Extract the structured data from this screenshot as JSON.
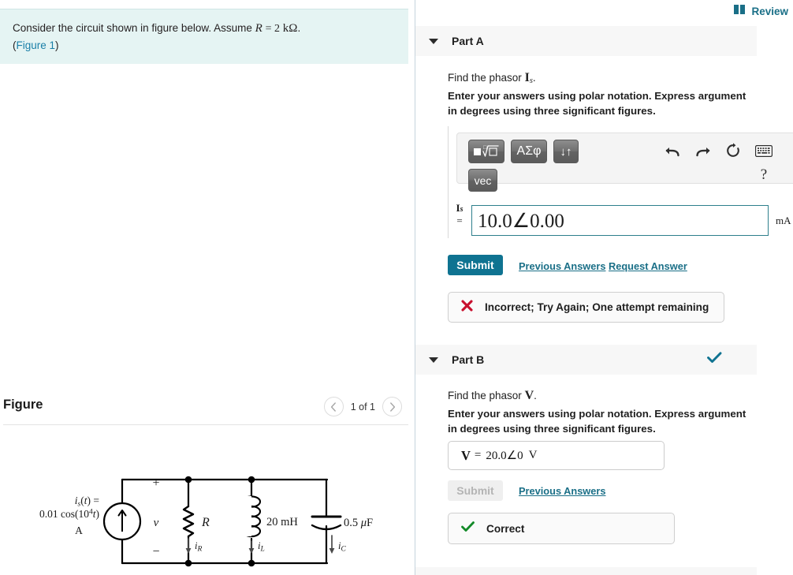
{
  "left": {
    "problem": {
      "text_before": "Consider the circuit shown in figure below. Assume",
      "assume_var": "R",
      "assume_eq": "= 2",
      "assume_unit": "kΩ",
      "period": ".",
      "figure_link_open": "(",
      "figure_link": "Figure 1",
      "figure_link_close": ")"
    },
    "figure": {
      "title": "Figure",
      "prev_icon": "chevron-left-icon",
      "counter": "1 of 1",
      "next_icon": "chevron-right-icon"
    },
    "circuit": {
      "source_line1": "i",
      "source_line1_sub": "s",
      "source_line1_rest": "(t) =",
      "source_line2": "0.01 cos(10",
      "source_line2_exp": "4",
      "source_line2_rest": "t)",
      "source_line3": "A",
      "plus_sign": "+",
      "minus_sign": "−",
      "voltage_label": "v",
      "resistor_label": "R",
      "inductor_label": "20 mH",
      "capacitor_label": "0.5 μF",
      "current_r": "i",
      "current_r_sub": "R",
      "current_l": "i",
      "current_l_sub": "L",
      "current_c": "i",
      "current_c_sub": "C"
    }
  },
  "right": {
    "review": {
      "icon": "book-icon",
      "label": "Review"
    },
    "parts": [
      {
        "id": "part-a",
        "caret_icon": "caret-down-icon",
        "title": "Part A",
        "status_icon": null,
        "prompt_prefix": "Find the phasor",
        "prompt_symbol": "I",
        "prompt_subscript": "s",
        "prompt_suffix": ".",
        "instruction": "Enter your answers using polar notation. Express argument in degrees using three significant figures.",
        "toolbar": {
          "buttons": [
            {
              "name": "template-sqrt-button",
              "label": "■√□"
            },
            {
              "name": "greek-symbols-button",
              "label": "ΑΣφ"
            },
            {
              "name": "more-templates-button",
              "label": "↓↑"
            },
            {
              "name": "vector-button",
              "label": "vec"
            }
          ],
          "icons": [
            {
              "name": "undo-icon",
              "label": "undo"
            },
            {
              "name": "redo-icon",
              "label": "redo"
            },
            {
              "name": "reset-icon",
              "label": "reset"
            },
            {
              "name": "keyboard-icon",
              "label": "keyboard"
            },
            {
              "name": "help-icon",
              "label": "?"
            }
          ]
        },
        "answer": {
          "label_symbol": "I",
          "label_subscript": "s",
          "label_equals": "=",
          "value": "10.0∠0.00",
          "value_magnitude": "10.0",
          "value_angle": "0.00",
          "unit": "mA"
        },
        "submit_label": "Submit",
        "submit_enabled": true,
        "links": [
          "Previous Answers",
          "Request Answer"
        ],
        "feedback": {
          "icon": "cross-icon",
          "icon_color": "#c8102e",
          "text": "Incorrect; Try Again; One attempt remaining"
        }
      },
      {
        "id": "part-b",
        "caret_icon": "caret-down-icon",
        "title": "Part B",
        "status_icon": "check-icon",
        "status_color": "#0f7391",
        "prompt_prefix": "Find the phasor",
        "prompt_symbol": "V",
        "prompt_subscript": "",
        "prompt_suffix": ".",
        "instruction": "Enter your answers using polar notation. Express argument in degrees using three significant figures.",
        "answer": {
          "label_symbol": "V",
          "label_equals": "=",
          "value": "20.0∠0",
          "unit": "V"
        },
        "submit_label": "Submit",
        "submit_enabled": false,
        "links": [
          "Previous Answers"
        ],
        "feedback": {
          "icon": "check-icon",
          "icon_color": "#128a28",
          "text": "Correct"
        }
      }
    ]
  }
}
